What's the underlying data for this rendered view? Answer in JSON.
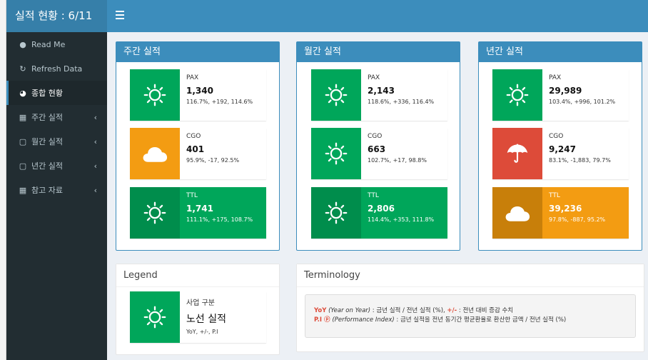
{
  "app": {
    "title": "실적 현황 : 6/11"
  },
  "sidebar": {
    "items": [
      {
        "label": "Read Me",
        "icon": "comment-icon"
      },
      {
        "label": "Refresh Data",
        "icon": "refresh-icon"
      },
      {
        "label": "종합 현황",
        "icon": "dashboard-icon"
      },
      {
        "label": "주간 실적",
        "icon": "calendar-icon"
      },
      {
        "label": "월간 실적",
        "icon": "calendar-icon"
      },
      {
        "label": "년간 실적",
        "icon": "calendar-icon"
      },
      {
        "label": "참고 자료",
        "icon": "calendar-icon"
      }
    ]
  },
  "panels": {
    "weekly": {
      "title": "주간 실적",
      "pax": {
        "label": "PAX",
        "value": "1,340",
        "sub": "116.7%, +192, 114.6%",
        "icon": "sun-icon"
      },
      "cgo": {
        "label": "CGO",
        "value": "401",
        "sub": "95.9%, -17, 92.5%",
        "icon": "cloud-icon"
      },
      "ttl": {
        "label": "TTL",
        "value": "1,741",
        "sub": "111.1%, +175, 108.7%",
        "icon": "sun-icon"
      }
    },
    "monthly": {
      "title": "월간 실적",
      "pax": {
        "label": "PAX",
        "value": "2,143",
        "sub": "118.6%, +336, 116.4%",
        "icon": "sun-icon"
      },
      "cgo": {
        "label": "CGO",
        "value": "663",
        "sub": "102.7%, +17, 98.8%",
        "icon": "sun-icon"
      },
      "ttl": {
        "label": "TTL",
        "value": "2,806",
        "sub": "114.4%, +353, 111.8%",
        "icon": "sun-icon"
      }
    },
    "yearly": {
      "title": "년간 실적",
      "pax": {
        "label": "PAX",
        "value": "29,989",
        "sub": "103.4%, +996, 101.2%",
        "icon": "sun-icon"
      },
      "cgo": {
        "label": "CGO",
        "value": "9,247",
        "sub": "83.1%, -1,883, 79.7%",
        "icon": "umbrella-icon"
      },
      "ttl": {
        "label": "TTL",
        "value": "39,236",
        "sub": "97.8%, -887, 95.2%",
        "icon": "cloud-icon"
      }
    }
  },
  "legend": {
    "title": "Legend",
    "label": "사업 구분",
    "value": "노선 실적",
    "sub": "YoY, +/-, P.I"
  },
  "terminology": {
    "title": "Terminology",
    "line1": {
      "kw1": "YoY",
      "it1": "(Year on Year)",
      "t1": " : 금년 실적 / 전년 실적 (%), ",
      "kw2": "+/-",
      "t2": " : 전년 대비 증감 수치"
    },
    "line2": {
      "kw1": "P.I",
      "mark": " ⓟ ",
      "it1": "(Performance Index)",
      "t1": " : 금년 실적을 전년 동기간 평균환율로 환산한 금액 / 전년 실적 (%)"
    }
  },
  "colors": {
    "header": "#3c8dbc",
    "logo": "#367fa9",
    "sidebar": "#222d32",
    "green": "#00a65a",
    "dark_green": "#008d4c",
    "orange": "#f39c12",
    "dark_orange": "#c87f0a",
    "red": "#dd4b39"
  }
}
